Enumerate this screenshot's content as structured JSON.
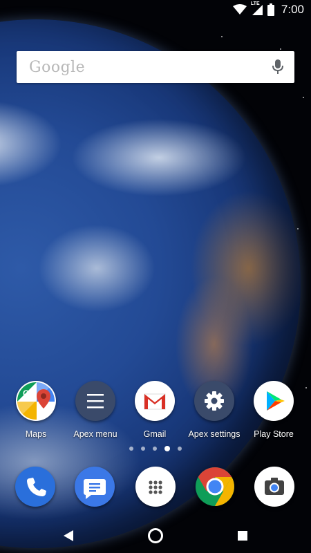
{
  "status_bar": {
    "time": "7:00",
    "network_label": "LTE",
    "icons": [
      "wifi-icon",
      "lte-signal-icon",
      "battery-icon"
    ]
  },
  "search": {
    "logo_text": "Google",
    "icons": [
      "mic-icon"
    ]
  },
  "apps": [
    {
      "label": "Maps",
      "icon": "maps-icon"
    },
    {
      "label": "Apex menu",
      "icon": "apex-menu-icon"
    },
    {
      "label": "Gmail",
      "icon": "gmail-icon"
    },
    {
      "label": "Apex settings",
      "icon": "gear-icon"
    },
    {
      "label": "Play Store",
      "icon": "play-store-icon"
    }
  ],
  "page_indicator": {
    "pages": 5,
    "active_index": 3
  },
  "dock": {
    "icons": [
      "phone-icon",
      "messages-icon",
      "app-drawer-icon",
      "chrome-icon",
      "camera-icon"
    ]
  },
  "nav_bar": {
    "icons": [
      "back-icon",
      "home-icon",
      "recents-icon"
    ]
  },
  "colors": {
    "space": "#020307",
    "ocean": "#234a95",
    "gmail_red": "#d93025",
    "chrome_green": "#0f9d58",
    "chrome_yellow": "#f4b400",
    "chrome_blue": "#4285f4",
    "phone_blue": "#2a6fdb"
  }
}
